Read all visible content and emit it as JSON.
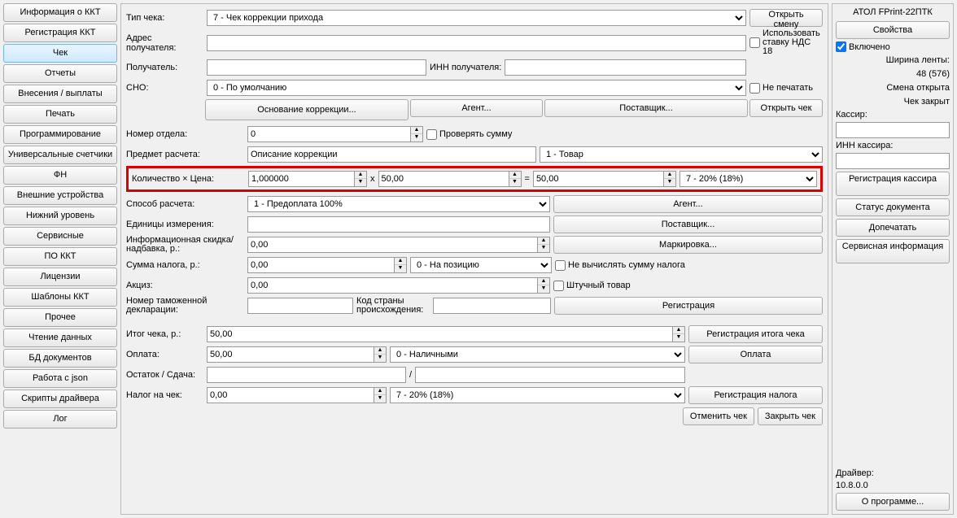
{
  "nav": [
    "Информация о ККТ",
    "Регистрация ККТ",
    "Чек",
    "Отчеты",
    "Внесения / выплаты",
    "Печать",
    "Программирование",
    "Универсальные счетчики",
    "ФН",
    "Внешние устройства",
    "Нижний уровень",
    "Сервисные",
    "ПО ККТ",
    "Лицензии",
    "Шаблоны ККТ",
    "Прочее",
    "Чтение данных",
    "БД документов",
    "Работа с json",
    "Скрипты драйвера",
    "Лог"
  ],
  "navActive": 2,
  "labels": {
    "tipCheka": "Тип чека:",
    "adresPoluch": "Адрес получателя:",
    "poluchatel": "Получатель:",
    "innPoluch": "ИНН получателя:",
    "sno": "СНО:",
    "nomerOtdela": "Номер отдела:",
    "predmetRasch": "Предмет расчета:",
    "kolichestvo": "Количество × Цена:",
    "sposobRasch": "Способ расчета:",
    "edIzm": "Единицы измерения:",
    "infSkidka": "Информационная скидка/надбавка, р.:",
    "summaNaloga": "Сумма налога, р.:",
    "akciz": "Акциз:",
    "nomerTamozh": "Номер таможенной декларации:",
    "kodStrany": "Код страны происхождения:",
    "itogCheka": "Итог чека, р.:",
    "oplata": "Оплата:",
    "ostatok": "Остаток / Сдача:",
    "nalogNaChek": "Налог на чек:"
  },
  "values": {
    "tipCheka": "7 - Чек коррекции прихода",
    "sno": "0 - По умолчанию",
    "nomerOtdela": "0",
    "predmetDesc": "Описание коррекции",
    "predmetType": "1 - Товар",
    "qty": "1,000000",
    "price": "50,00",
    "sum": "50,00",
    "vat": "7 - 20% (18%)",
    "sposob": "1 - Предоплата 100%",
    "skidka": "0,00",
    "summaNaloga": "0,00",
    "nalogPos": "0 - На позицию",
    "akciz": "0,00",
    "itog": "50,00",
    "oplataVal": "50,00",
    "oplataType": "0 - Наличными",
    "nalogChek": "0,00",
    "nalogChekType": "7 - 20% (18%)"
  },
  "buttons": {
    "otkrytSmenu": "Открыть смену",
    "osnovanie": "Основание коррекции...",
    "agent": "Агент...",
    "postavshik": "Поставщик...",
    "otkrytChek": "Открыть чек",
    "markirovka": "Маркировка...",
    "registraciya": "Регистрация",
    "regItoga": "Регистрация итога чека",
    "oplata": "Оплата",
    "regNaloga": "Регистрация налога",
    "otmenit": "Отменить чек",
    "zakryt": "Закрыть чек"
  },
  "checks": {
    "ispNds": "Использовать ставку НДС 18",
    "nePechatat": "Не печатать",
    "proveryatSummu": "Проверять сумму",
    "neVychislyat": "Не вычислять сумму налога",
    "shtuchny": "Штучный товар",
    "vklyucheno": "Включено"
  },
  "right": {
    "title": "АТОЛ FPrint-22ПТК",
    "svoistva": "Свойства",
    "shirinaLbl": "Ширина ленты:",
    "shirinaVal": "48 (576)",
    "smenaOtkr": "Смена открыта",
    "chekZakryt": "Чек закрыт",
    "kassir": "Кассир:",
    "innKassira": "ИНН кассира:",
    "regKassira": "Регистрация кассира",
    "statusDoc": "Статус документа",
    "dopechatat": "Допечатать",
    "servisnaya": "Сервисная информация",
    "driver": "Драйвер:",
    "driverVer": "10.8.0.0",
    "oProgramme": "О программе..."
  },
  "math": {
    "x": "x",
    "eq": "=",
    "slash": "/"
  }
}
